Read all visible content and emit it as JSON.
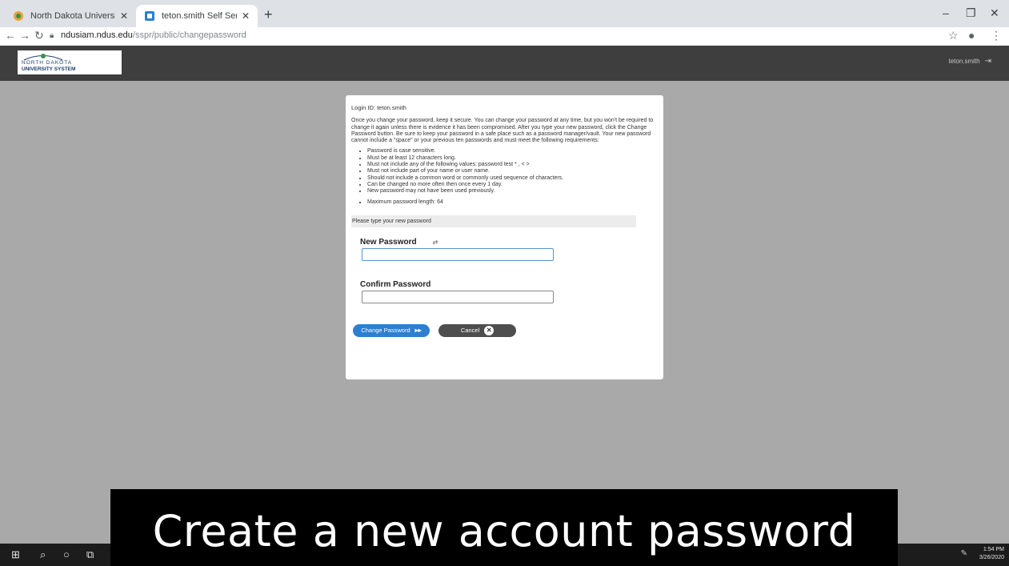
{
  "browser": {
    "tabs": [
      {
        "title": "North Dakota University System",
        "active": false
      },
      {
        "title": "teton.smith Self Service Passwor",
        "active": true
      }
    ],
    "new_tab": "+",
    "controls": {
      "minimize": "–",
      "maximize": "❐",
      "close": "✕"
    },
    "url_host": "ndusiam.ndus.edu",
    "url_path": "/sspr/public/changepassword"
  },
  "header": {
    "logo_line1": "NORTH DAKOTA",
    "logo_line2": "UNIVERSITY SYSTEM",
    "username": "teton.smith"
  },
  "form": {
    "login_id": "Login ID: teton.smith",
    "intro": "Once you change your password, keep it secure. You can change your password at any time, but you won't be required to change it again unless there is evidence it has been compromised. After you type your new password, click the Change Password button. Be sure to keep your password in a safe place such as a password manager/vault. Your new password cannot include a \"space\" or your previous ten passwords and must meet the following requirements:",
    "requirements": [
      "Password is case sensitive.",
      "Must be at least 12 characters long.",
      "Must not include any of the following values: password test * , < >",
      "Must not include part of your name or user name.",
      "Should not include a common word or commonly used sequence of characters.",
      "Can be changed no more often then once every 1 day.",
      "New password may not have been used previously."
    ],
    "max_length": "Maximum password length: 64",
    "prompt": "Please type your new password",
    "new_password_label": "New Password",
    "new_password_value": "",
    "confirm_password_label": "Confirm Password",
    "confirm_password_value": "",
    "change_button": "Change Password",
    "cancel_button": "Cancel"
  },
  "taskbar": {
    "time": "1:54 PM",
    "date": "3/26/2020"
  },
  "caption": "Create a new account password",
  "colors": {
    "page_bg": "#a9a9a9",
    "header_bg": "#3e3e3e",
    "primary": "#2d7fd0",
    "secondary": "#4e4e4e"
  }
}
